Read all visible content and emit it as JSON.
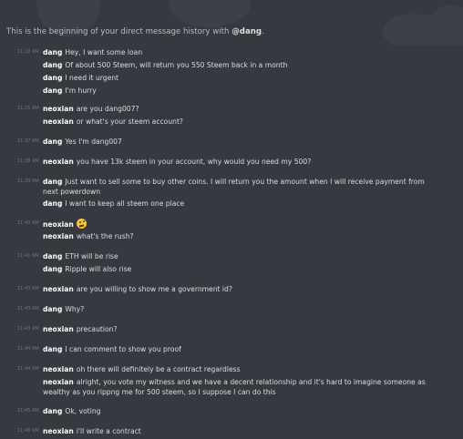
{
  "header": {
    "prefix": "This is the beginning of your direct message history with",
    "handle": "@dang"
  },
  "messages": [
    {
      "time": "11:20 AM",
      "author": "dang",
      "text": "Hey, I want some loan"
    },
    {
      "time": "",
      "author": "dang",
      "text": "Of about 500 Steem, will return you 550 Steem back in a month"
    },
    {
      "time": "",
      "author": "dang",
      "text": "I need it urgent"
    },
    {
      "time": "",
      "author": "dang",
      "text": "I'm hurry"
    },
    {
      "time": "11:31 AM",
      "author": "neoxian",
      "text": "are you dang007?"
    },
    {
      "time": "",
      "author": "neoxian",
      "text": "or what's your steem account?"
    },
    {
      "time": "11:37 AM",
      "author": "dang",
      "text": "Yes I'm dang007"
    },
    {
      "time": "11:38 AM",
      "author": "neoxian",
      "text": "you have 13k steem in your account, why would you need my 500?"
    },
    {
      "time": "11:39 AM",
      "author": "dang",
      "text": "Just want to sell some to buy other coins. I will return you the amount when I will receive payment from next powerdown"
    },
    {
      "time": "",
      "author": "dang",
      "text": "I want to keep all steem one place"
    },
    {
      "time": "11:40 AM",
      "author": "neoxian",
      "text": "",
      "emoji": "thinking-face-emoji"
    },
    {
      "time": "",
      "author": "neoxian",
      "text": "what's the rush?"
    },
    {
      "time": "11:41 AM",
      "author": "dang",
      "text": "ETH will be rise"
    },
    {
      "time": "",
      "author": "dang",
      "text": "Ripple will also rise"
    },
    {
      "time": "11:43 AM",
      "author": "neoxian",
      "text": "are you willing to show me a government id?"
    },
    {
      "time": "11:43 AM",
      "author": "dang",
      "text": "Why?"
    },
    {
      "time": "11:43 AM",
      "author": "neoxian",
      "text": "precaution?"
    },
    {
      "time": "11:44 AM",
      "author": "dang",
      "text": "I can comment to show you proof"
    },
    {
      "time": "11:44 AM",
      "author": "neoxian",
      "text": "oh there will definitely be a contract regardless"
    },
    {
      "time": "",
      "author": "neoxian",
      "text": "alright, you vote my witness and we have a decent relationship and it's hard to imagine someone as wealthy as you rippng me for 500 steem, so I suppose I can do this"
    },
    {
      "time": "11:45 AM",
      "author": "dang",
      "text": "Ok, voting"
    },
    {
      "time": "11:46 AM",
      "author": "neoxian",
      "text": "i'll write a contract"
    }
  ]
}
